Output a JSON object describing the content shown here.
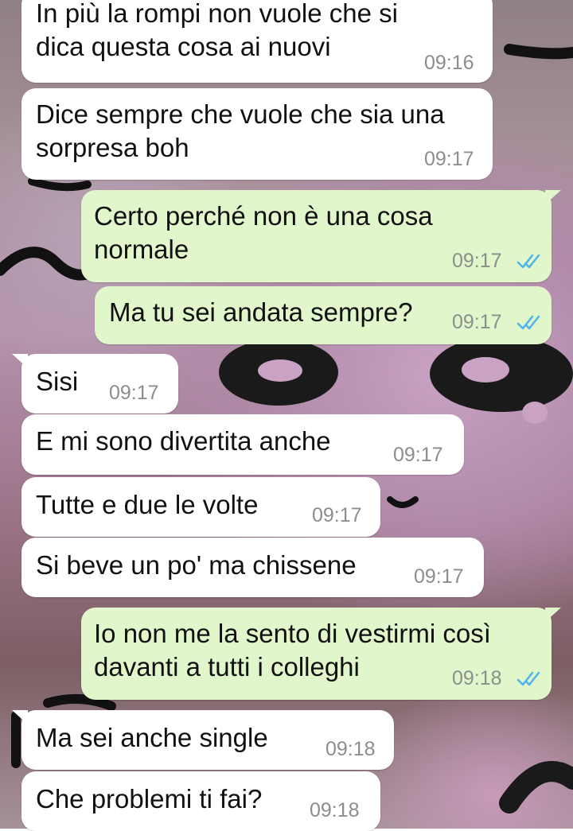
{
  "colors": {
    "incoming_bubble": "#ffffff",
    "outgoing_bubble": "#e1f7cb",
    "read_ticks": "#4fb6ec",
    "timestamp": "#8a8f8b"
  },
  "messages": [
    {
      "direction": "incoming",
      "lines": [
        "In più la rompi non vuole che si",
        "dica questa cosa ai nuovi"
      ],
      "time": "09:16"
    },
    {
      "direction": "incoming",
      "lines": [
        "Dice sempre che vuole che sia una",
        "sorpresa boh"
      ],
      "time": "09:17"
    },
    {
      "direction": "outgoing",
      "lines": [
        "Certo perché non è una cosa",
        "normale"
      ],
      "time": "09:17",
      "status": "read"
    },
    {
      "direction": "outgoing",
      "lines": [
        "Ma tu sei andata sempre?"
      ],
      "time": "09:17",
      "status": "read"
    },
    {
      "direction": "incoming",
      "lines": [
        "Sisi"
      ],
      "time": "09:17"
    },
    {
      "direction": "incoming",
      "lines": [
        "E mi sono divertita anche"
      ],
      "time": "09:17"
    },
    {
      "direction": "incoming",
      "lines": [
        "Tutte e due le volte"
      ],
      "time": "09:17"
    },
    {
      "direction": "incoming",
      "lines": [
        "Si beve un po' ma chissene"
      ],
      "time": "09:17"
    },
    {
      "direction": "outgoing",
      "lines": [
        "Io non me la sento di vestirmi così",
        "davanti a tutti i colleghi"
      ],
      "time": "09:18",
      "status": "read"
    },
    {
      "direction": "incoming",
      "lines": [
        "Ma sei anche single"
      ],
      "time": "09:18"
    },
    {
      "direction": "incoming",
      "lines": [
        "Che problemi ti fai?"
      ],
      "time": "09:18"
    }
  ]
}
